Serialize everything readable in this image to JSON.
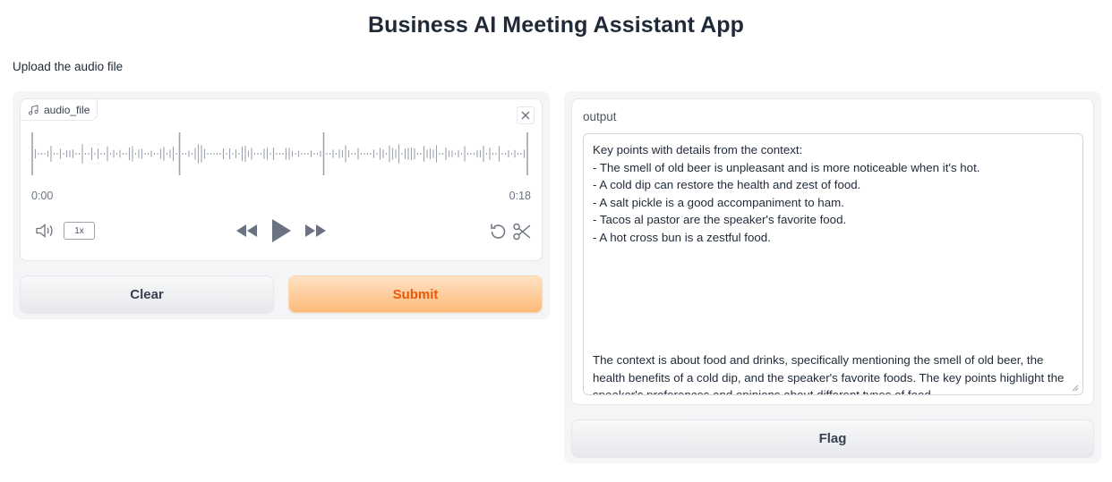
{
  "app": {
    "title": "Business AI Meeting Assistant App",
    "description": "Upload the audio file"
  },
  "audio": {
    "label": "audio_file",
    "time_start": "0:00",
    "time_end": "0:18",
    "playback_rate": "1x"
  },
  "buttons": {
    "clear": "Clear",
    "submit": "Submit",
    "flag": "Flag"
  },
  "output": {
    "label": "output",
    "text": "Key points with details from the context:\n- The smell of old beer is unpleasant and is more noticeable when it's hot.\n- A cold dip can restore the health and zest of food.\n- A salt pickle is a good accompaniment to ham.\n- Tacos al pastor are the speaker's favorite food.\n- A hot cross bun is a zestful food.\n\n\n\n\n\n\nThe context is about food and drinks, specifically mentioning the smell of old beer, the health benefits of a cold dip, and the speaker's favorite foods. The key points highlight the speaker's preferences and opinions about different types of food."
  },
  "icons": {
    "label": "music-icon",
    "clear": "close-icon",
    "volume": "volume-icon",
    "rewind": "rewind-icon",
    "play": "play-icon",
    "forward": "fast-forward-icon",
    "reset": "undo-icon",
    "trim": "scissors-icon"
  },
  "colors": {
    "accent": "#ea580c",
    "submit_bg": "#fdba7a",
    "waveform": "#9ca3af"
  }
}
